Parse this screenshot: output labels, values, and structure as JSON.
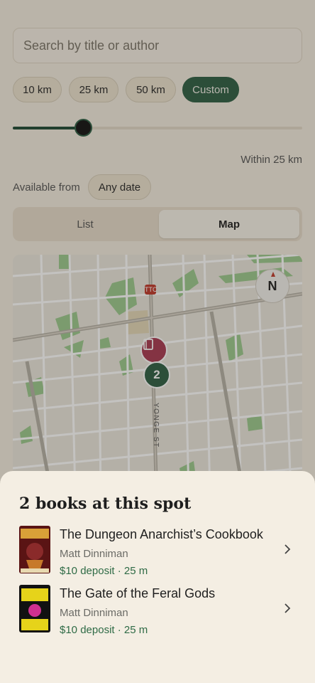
{
  "search": {
    "placeholder": "Search by title or author"
  },
  "distance_chips": [
    "10 km",
    "25 km",
    "50 km",
    "Custom"
  ],
  "active_chip": "Custom",
  "slider": {
    "value_km": 25,
    "max_km": 100,
    "fraction": 0.24
  },
  "within_label": "Within 25 km",
  "availability": {
    "label": "Available from",
    "value": "Any date"
  },
  "view_tabs": {
    "list": "List",
    "map": "Map",
    "selected": "Map"
  },
  "map": {
    "street_label": "YONGE ST",
    "cluster_count": "2",
    "compass_label": "N",
    "subway_label": "TTC"
  },
  "sheet": {
    "title": "2 books at this spot",
    "books": [
      {
        "title": "The Dungeon Anarchist’s Cookbook",
        "author": "Matt Dinniman",
        "meta": "$10 deposit · 25 m",
        "cover_colors": [
          "#7a1a1a",
          "#d9a038"
        ]
      },
      {
        "title": "The Gate of the Feral Gods",
        "author": "Matt Dinniman",
        "meta": "$10 deposit · 25 m",
        "cover_colors": [
          "#111111",
          "#e6d31a"
        ]
      }
    ]
  },
  "colors": {
    "accent_green": "#2f5f45",
    "pin_red": "#a83a52",
    "background": "#f3ece0"
  }
}
